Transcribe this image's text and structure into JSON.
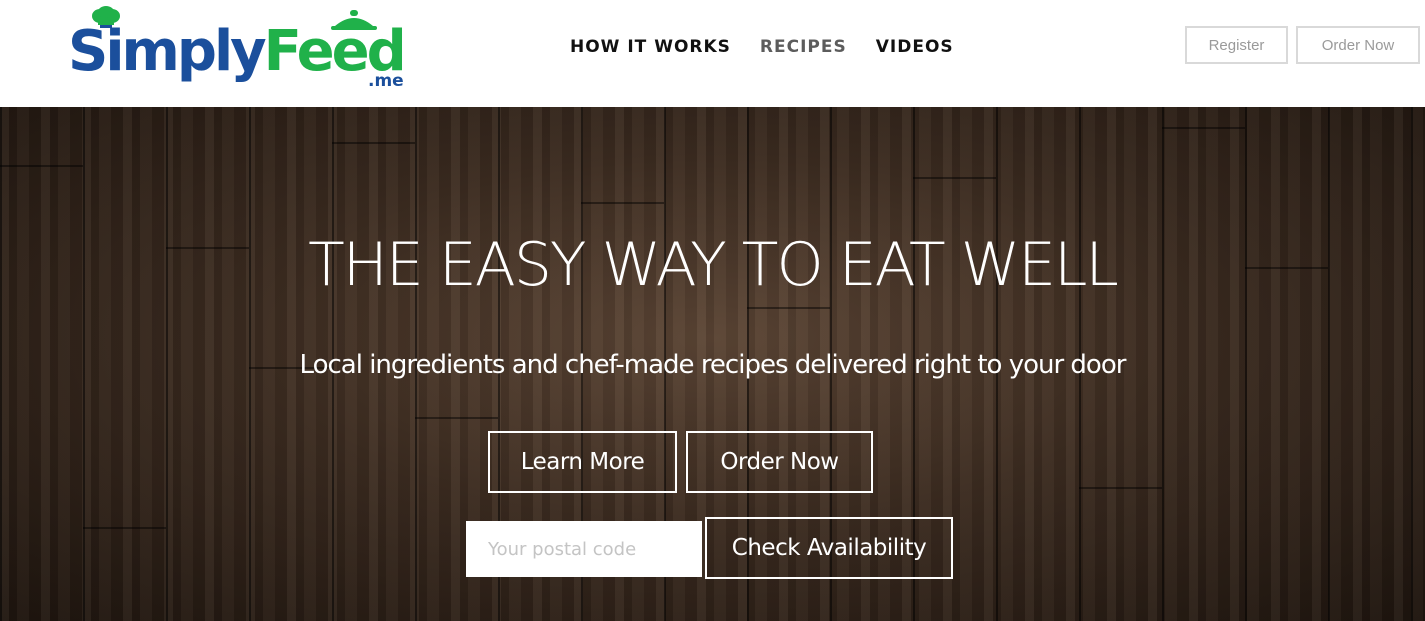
{
  "brand": {
    "name_part1": "Simply",
    "name_part2": "Feed",
    "suffix": ".me",
    "primary_color": "#1b4f9c",
    "accent_color": "#20b14a"
  },
  "nav": {
    "items": [
      {
        "label": "HOW IT WORKS"
      },
      {
        "label": "RECIPES"
      },
      {
        "label": "VIDEOS"
      }
    ]
  },
  "header_buttons": {
    "register": "Register",
    "order_now": "Order Now"
  },
  "hero": {
    "title": "THE EASY WAY TO EAT WELL",
    "subtitle": "Local ingredients and chef-made recipes delivered right to your door",
    "learn_more": "Learn More",
    "order_now": "Order Now",
    "postal_placeholder": "Your postal code",
    "postal_value": "",
    "check_availability": "Check Availability"
  },
  "icons": {
    "logo_chef_hat_fork": "chef-hat-fork-icon",
    "logo_cooking_pot": "cooking-pot-icon"
  }
}
